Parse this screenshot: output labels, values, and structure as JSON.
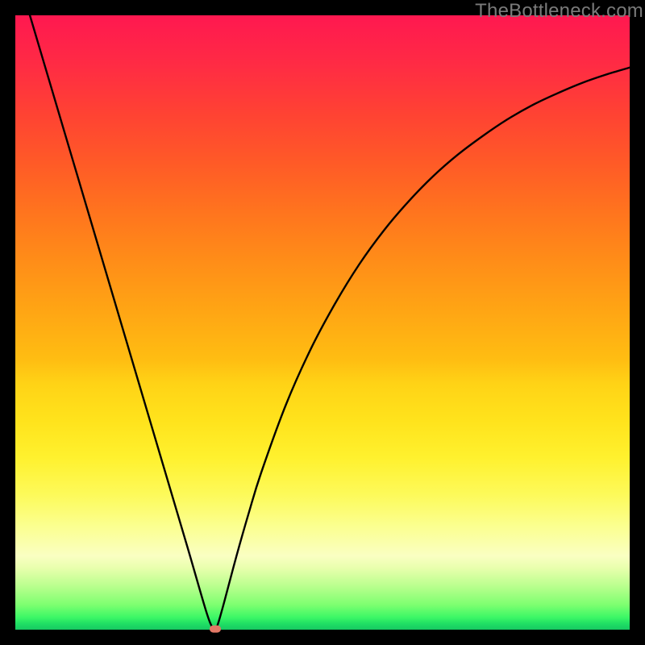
{
  "watermark": "TheBottleneck.com",
  "colors": {
    "page_background": "#000000",
    "curve_stroke": "#000000",
    "marker_fill": "#e27866",
    "watermark_color": "#7a7a7a"
  },
  "chart_data": {
    "type": "line",
    "title": "",
    "xlabel": "",
    "ylabel": "",
    "xlim": [
      0,
      100
    ],
    "ylim": [
      0,
      100
    ],
    "grid": false,
    "legend": false,
    "series": [
      {
        "name": "bottleneck-curve",
        "x": [
          0,
          4,
          8,
          12,
          16,
          20,
          24,
          28,
          31,
          32,
          32.5,
          33,
          34,
          36,
          38,
          40,
          44,
          48,
          52,
          56,
          60,
          64,
          68,
          72,
          76,
          80,
          84,
          88,
          92,
          96,
          100
        ],
        "values": [
          108,
          94.5,
          81,
          67.5,
          54,
          40.5,
          27,
          13.5,
          3.2,
          0.5,
          0,
          1,
          4.5,
          12,
          19,
          25.5,
          36.5,
          45.5,
          53,
          59.5,
          65,
          69.7,
          73.8,
          77.3,
          80.3,
          83,
          85.3,
          87.2,
          88.9,
          90.3,
          91.5
        ]
      }
    ],
    "annotations": [
      {
        "name": "minimum-marker",
        "x": 32.5,
        "y": 0,
        "shape": "rounded-rect",
        "fill": "#e27866"
      }
    ],
    "background_gradient": {
      "orientation": "vertical",
      "stops": [
        {
          "pos": 0.0,
          "color": "#ff1850"
        },
        {
          "pos": 0.5,
          "color": "#ffb013"
        },
        {
          "pos": 0.78,
          "color": "#fdfa5a"
        },
        {
          "pos": 0.9,
          "color": "#e8ffad"
        },
        {
          "pos": 1.0,
          "color": "#17c962"
        }
      ]
    }
  }
}
